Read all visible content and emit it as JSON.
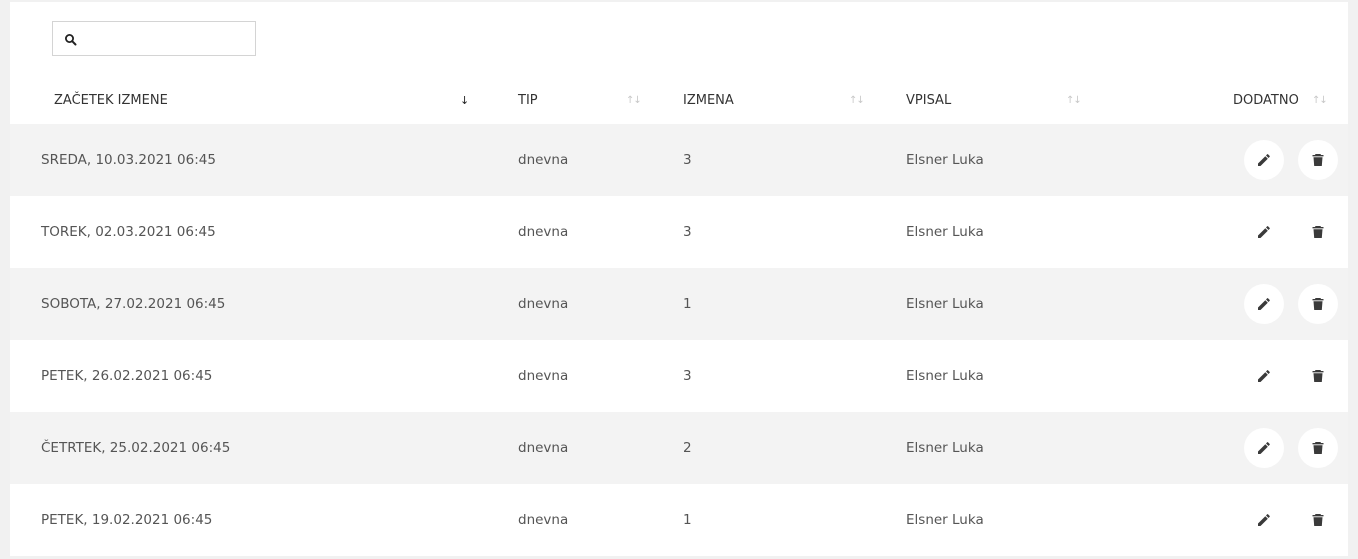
{
  "search": {
    "placeholder": "",
    "value": "",
    "icon": "search-icon"
  },
  "columns": [
    {
      "key": "start",
      "label": "ZAČETEK IZMENE",
      "sort": "↓"
    },
    {
      "key": "type",
      "label": "TIP",
      "sort": "↑↓"
    },
    {
      "key": "shift",
      "label": "IZMENA",
      "sort": "↑↓"
    },
    {
      "key": "by",
      "label": "VPISAL",
      "sort": "↑↓"
    },
    {
      "key": "extra",
      "label": "DODATNO",
      "sort": "↑↓"
    }
  ],
  "rows": [
    {
      "start": "SREDA, 10.03.2021 06:45",
      "type": "dnevna",
      "shift": "3",
      "by": "Elsner Luka"
    },
    {
      "start": "TOREK, 02.03.2021 06:45",
      "type": "dnevna",
      "shift": "3",
      "by": "Elsner Luka"
    },
    {
      "start": "SOBOTA, 27.02.2021 06:45",
      "type": "dnevna",
      "shift": "1",
      "by": "Elsner Luka"
    },
    {
      "start": "PETEK, 26.02.2021 06:45",
      "type": "dnevna",
      "shift": "3",
      "by": "Elsner Luka"
    },
    {
      "start": "ČETRTEK, 25.02.2021 06:45",
      "type": "dnevna",
      "shift": "2",
      "by": "Elsner Luka"
    },
    {
      "start": "PETEK, 19.02.2021 06:45",
      "type": "dnevna",
      "shift": "1",
      "by": "Elsner Luka"
    }
  ],
  "actions": {
    "edit_icon": "pencil-icon",
    "delete_icon": "trash-icon"
  },
  "colors": {
    "row_alt": "#f3f3f3",
    "text": "#555555",
    "sort_inactive": "#c8c8c8"
  }
}
